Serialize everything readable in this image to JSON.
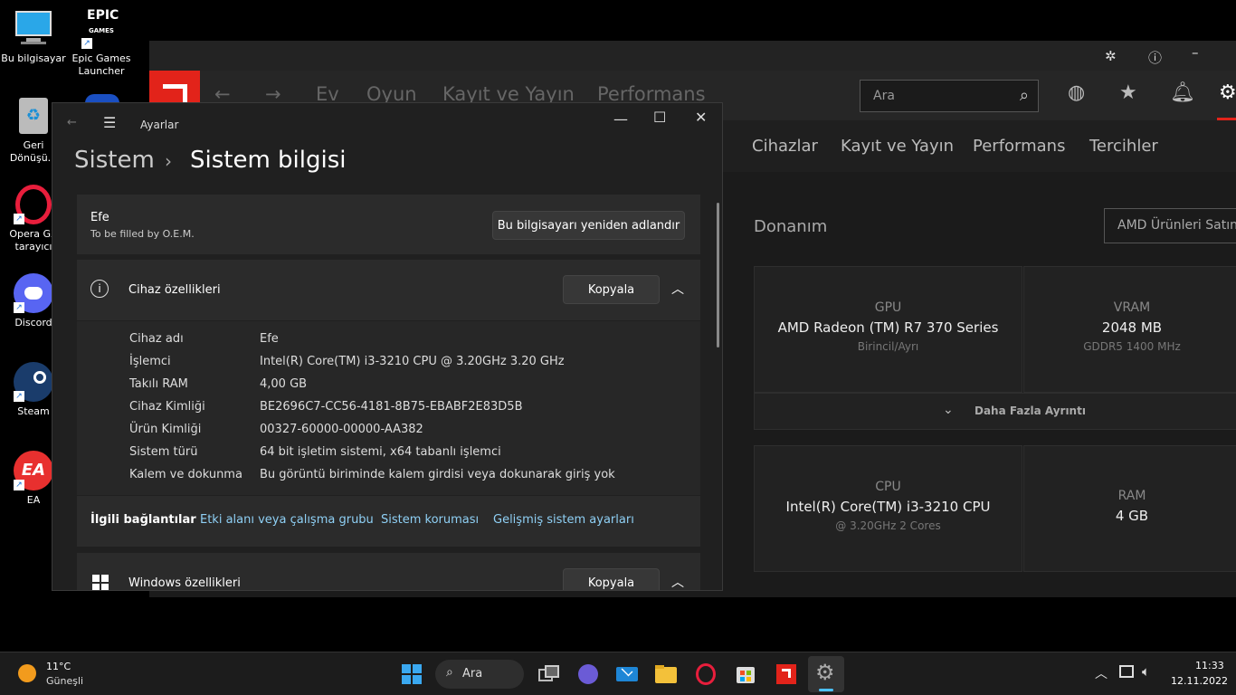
{
  "desktop": {
    "icons": [
      {
        "label": "Bu bilgisayar",
        "icon": "computer-icon"
      },
      {
        "label": "Epic Games Launcher",
        "icon": "epic-games-icon"
      },
      {
        "label": "Geri Dönüşü...",
        "icon": "recycle-bin-icon"
      },
      {
        "label": "Opera GX tarayıcı",
        "icon": "opera-gx-icon"
      },
      {
        "label": "Discord",
        "icon": "discord-icon"
      },
      {
        "label": "Steam",
        "icon": "steam-icon"
      },
      {
        "label": "EA",
        "icon": "ea-icon"
      }
    ]
  },
  "amd": {
    "nav": [
      "Ev",
      "Oyun",
      "Kayıt ve Yayın",
      "Performans"
    ],
    "search_placeholder": "Ara",
    "subnav": [
      "Cihazlar",
      "Kayıt ve Yayın",
      "Performans",
      "Tercihler"
    ],
    "section_title": "Donanım",
    "sell_button": "AMD Ürünleri Satın",
    "gpu": {
      "label": "GPU",
      "value": "AMD Radeon (TM) R7 370 Series",
      "sub": "Birincil/Ayrı"
    },
    "vram": {
      "label": "VRAM",
      "value": "2048 MB",
      "sub": "GDDR5 1400 MHz"
    },
    "more_details": "Daha Fazla Ayrıntı",
    "cpu": {
      "label": "CPU",
      "value": "Intel(R) Core(TM) i3-3210 CPU",
      "sub": "@ 3.20GHz 2 Cores"
    },
    "ram": {
      "label": "RAM",
      "value": "4 GB"
    }
  },
  "settings": {
    "app_title": "Ayarlar",
    "breadcrumb_parent": "Sistem",
    "breadcrumb_current": "Sistem bilgisi",
    "device_name": "Efe",
    "device_sub": "To be filled by O.E.M.",
    "rename_button": "Bu bilgisayarı yeniden adlandır",
    "device_specs_title": "Cihaz özellikleri",
    "copy_button": "Kopyala",
    "specs": [
      {
        "key": "Cihaz adı",
        "value": "Efe"
      },
      {
        "key": "İşlemci",
        "value": "Intel(R) Core(TM) i3-3210 CPU @ 3.20GHz   3.20 GHz"
      },
      {
        "key": "Takılı RAM",
        "value": "4,00 GB"
      },
      {
        "key": "Cihaz Kimliği",
        "value": "BE2696C7-CC56-4181-8B75-EBABF2E83D5B"
      },
      {
        "key": "Ürün Kimliği",
        "value": "00327-60000-00000-AA382"
      },
      {
        "key": "Sistem türü",
        "value": "64 bit işletim sistemi, x64 tabanlı işlemci"
      },
      {
        "key": "Kalem ve dokunma",
        "value": "Bu görüntü biriminde kalem girdisi veya dokunarak giriş yok"
      }
    ],
    "related_label": "İlgili bağlantılar",
    "related_links": [
      "Etki alanı veya çalışma grubu",
      "Sistem koruması",
      "Gelişmiş sistem ayarları"
    ],
    "windows_specs_title": "Windows özellikleri"
  },
  "taskbar": {
    "weather_temp": "11°C",
    "weather_desc": "Güneşli",
    "search_label": "Ara",
    "time": "11:33",
    "date": "12.11.2022"
  }
}
